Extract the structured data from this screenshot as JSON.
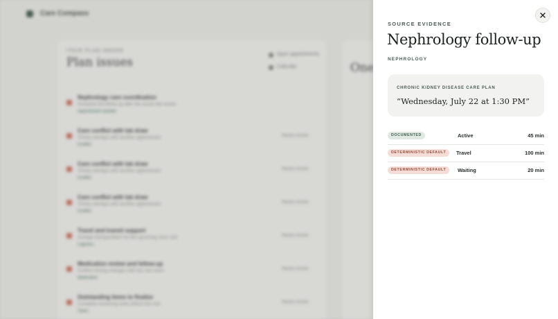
{
  "background": {
    "brand": "Care Compass",
    "card": {
      "kicker": "YOUR PLAN ORDER",
      "title": "Plan issues",
      "side_links": [
        "Open appointments",
        "Calendar"
      ],
      "rows": [
        {
          "title": "Nephrology care coordination",
          "sub": "Schedule the follow-up after the recent lab review",
          "tag": "Appointment needed",
          "right": ""
        },
        {
          "title": "Care conflict with lab draw",
          "sub": "Timing overlaps with another appointment",
          "tag": "Conflict",
          "right": "Needs review"
        },
        {
          "title": "Care conflict with lab draw",
          "sub": "Timing overlaps with another appointment",
          "tag": "Conflict",
          "right": "Needs review"
        },
        {
          "title": "Care conflict with lab draw",
          "sub": "Timing overlaps with another appointment",
          "tag": "Conflict",
          "right": "Needs review"
        },
        {
          "title": "Travel and transit support",
          "sub": "Arrange transportation for the upcoming clinic visit",
          "tag": "Logistics",
          "right": "Needs review"
        },
        {
          "title": "Medication review and follow-up",
          "sub": "Confirm dosing changes with the care team",
          "tag": "Medication",
          "right": "Needs review"
        },
        {
          "title": "Outstanding items to finalize",
          "sub": "Complete remaining tasks before the visit",
          "tag": "Tasks",
          "right": "Needs review"
        }
      ]
    },
    "card2": {
      "title": "One day"
    }
  },
  "drawer": {
    "kicker": "SOURCE EVIDENCE",
    "title": "Nephrology follow-up",
    "department": "NEPHROLOGY",
    "quote": {
      "label": "CHRONIC KIDNEY DISEASE CARE PLAN",
      "text": "“Wednesday, July 22 at 1:30 PM”"
    },
    "rows": [
      {
        "badge": "DOCUMENTED",
        "badge_kind": "doc",
        "label": "Active",
        "value": "45 min"
      },
      {
        "badge": "DETERMINISTIC DEFAULT",
        "badge_kind": "def",
        "label": "Travel",
        "value": "100 min"
      },
      {
        "badge": "DETERMINISTIC DEFAULT",
        "badge_kind": "def",
        "label": "Waiting",
        "value": "20 min"
      }
    ],
    "close_icon": "close-icon"
  },
  "colors": {
    "accent": "#2d4a3a",
    "documented_badge": "#dfe9e2",
    "default_badge": "#f4ddd7"
  }
}
